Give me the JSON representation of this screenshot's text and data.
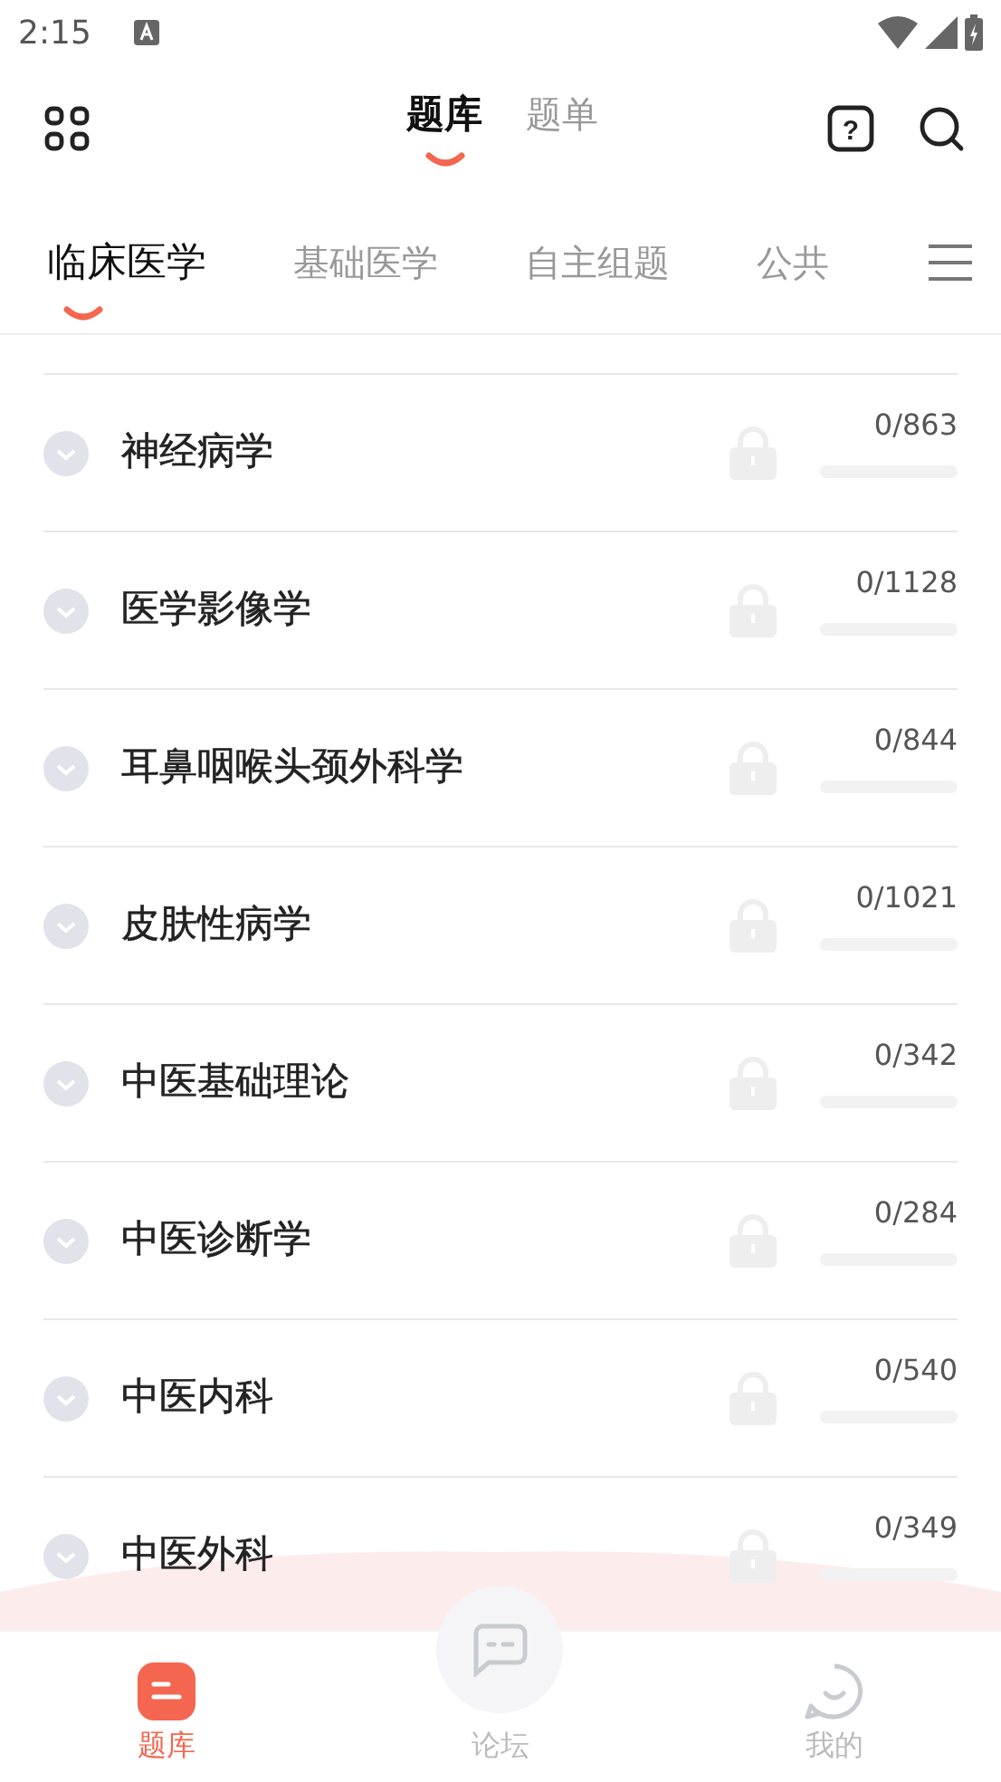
{
  "status_bar": {
    "time": "2:15"
  },
  "header": {
    "help_glyph": "?",
    "tabs": [
      {
        "label": "题库",
        "selected": true
      },
      {
        "label": "题单",
        "selected": false
      }
    ]
  },
  "category_tabs": [
    {
      "label": "临床医学",
      "selected": true
    },
    {
      "label": "基础医学",
      "selected": false
    },
    {
      "label": "自主组题",
      "selected": false
    },
    {
      "label": "公共",
      "selected": false
    }
  ],
  "subjects": [
    {
      "name": "神经病学",
      "count": "0/863",
      "level": 0,
      "locked": true
    },
    {
      "name": "医学影像学",
      "count": "0/1128",
      "level": 0,
      "locked": true
    },
    {
      "name": "耳鼻咽喉头颈外科学",
      "count": "0/844",
      "level": 0,
      "locked": true
    },
    {
      "name": "皮肤性病学",
      "count": "0/1021",
      "level": 0,
      "locked": true
    },
    {
      "name": "中医基础理论",
      "count": "0/342",
      "level": 0,
      "locked": true
    },
    {
      "name": "中医诊断学",
      "count": "0/284",
      "level": 0,
      "locked": true
    },
    {
      "name": "中医内科",
      "count": "0/540",
      "level": 0,
      "locked": true
    },
    {
      "name": "中医外科",
      "count": "0/349",
      "level": 0,
      "locked": true
    }
  ],
  "bottom_nav": [
    {
      "label": "题库",
      "kind": "bank",
      "selected": true
    },
    {
      "label": "论坛",
      "kind": "forum",
      "selected": false
    },
    {
      "label": "我的",
      "kind": "profile",
      "selected": false
    }
  ]
}
